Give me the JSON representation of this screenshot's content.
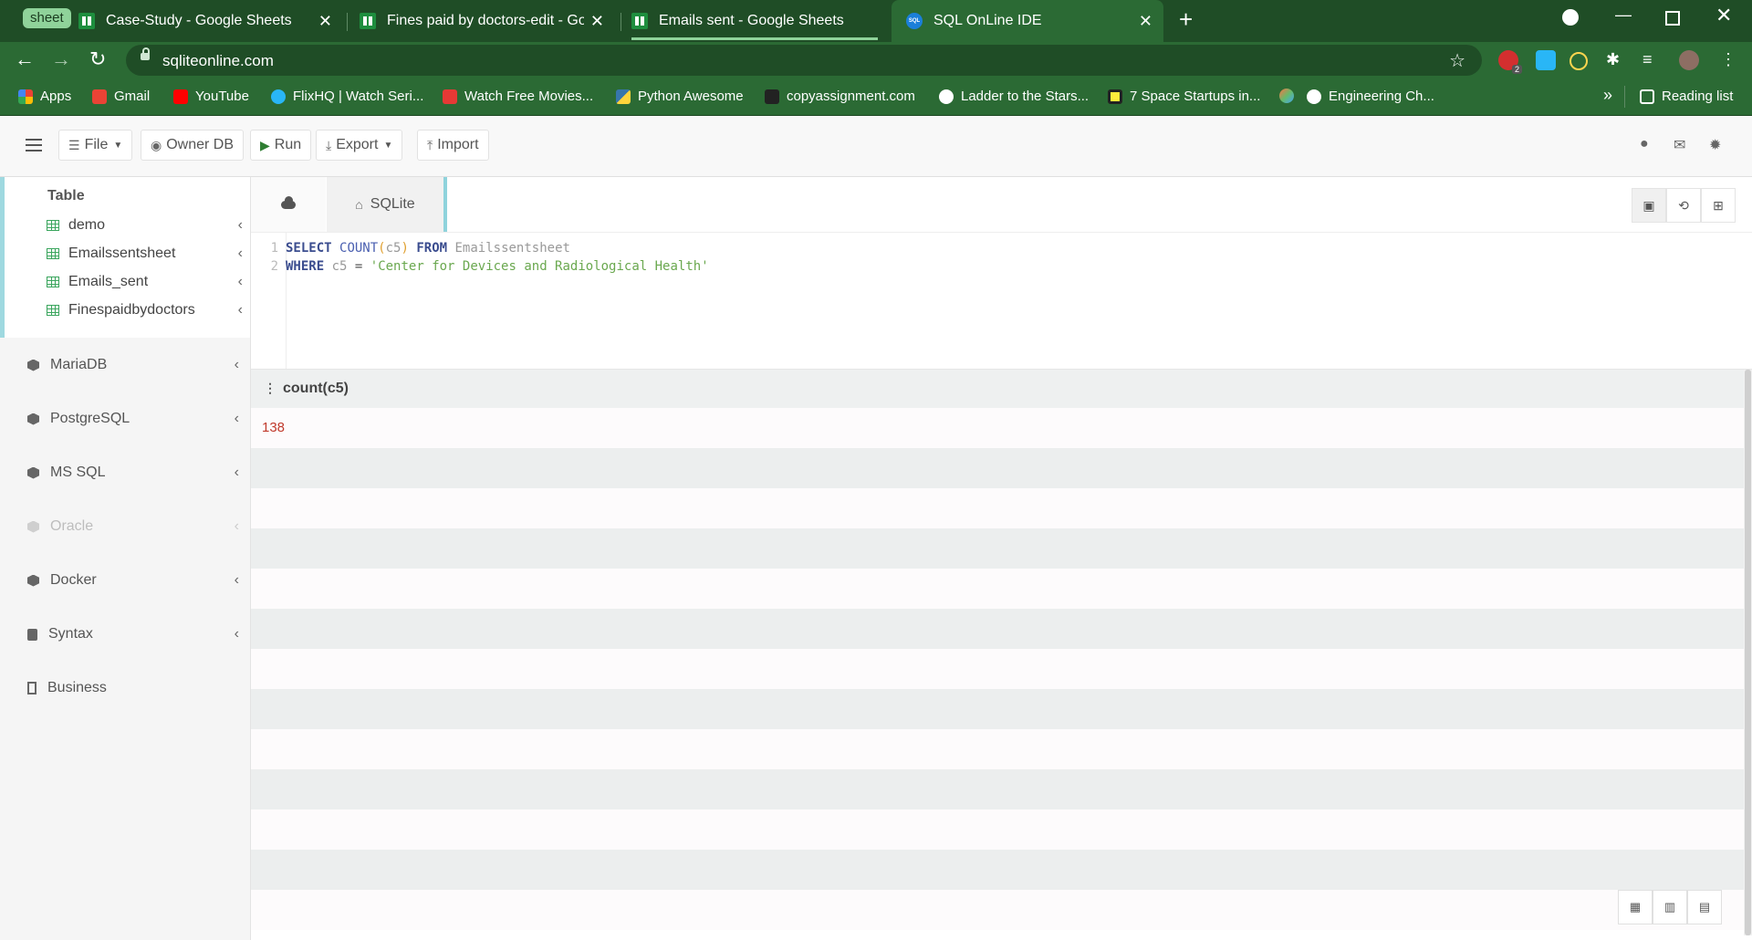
{
  "browser": {
    "tab_group_label": "sheet",
    "tabs": [
      {
        "title": "Case-Study - Google Sheets",
        "icon": "google-sheets-icon"
      },
      {
        "title": "Fines paid by doctors-edit - Goo",
        "icon": "google-sheets-icon"
      },
      {
        "title": "Emails sent - Google Sheets",
        "icon": "google-sheets-icon"
      },
      {
        "title": "SQL OnLine IDE",
        "icon": "sql-icon",
        "active": true
      }
    ],
    "url": "sqliteonline.com",
    "extension_badge": "2",
    "bookmarks": [
      {
        "label": "Apps",
        "icon": "apps-grid-icon",
        "color": "#f4b400"
      },
      {
        "label": "Gmail",
        "icon": "gmail-icon",
        "color": "#ea4335"
      },
      {
        "label": "YouTube",
        "icon": "youtube-icon",
        "color": "#ff0000"
      },
      {
        "label": "FlixHQ | Watch Seri...",
        "icon": "flixhq-icon",
        "color": "#29b6f6"
      },
      {
        "label": "Watch Free Movies...",
        "icon": "play-icon",
        "color": "#e53935"
      },
      {
        "label": "Python Awesome",
        "icon": "python-icon",
        "color": "#ffd43b"
      },
      {
        "label": "copyassignment.com",
        "icon": "copyassignment-icon",
        "color": "#222222"
      },
      {
        "label": "Ladder to the Stars...",
        "icon": "rocket-icon",
        "color": "#ffffff"
      },
      {
        "label": "7 Space Startups in...",
        "icon": "square-logo-icon",
        "color": "#ffeb3b"
      },
      {
        "label": "",
        "icon": "colorful-logo-icon",
        "color": "#ff7043"
      },
      {
        "label": "Engineering Ch...",
        "icon": "gear-icon",
        "color": "#ffffff"
      }
    ],
    "overflow": "»",
    "reading_list": "Reading list"
  },
  "toolbar": {
    "file": "File",
    "owner_db": "Owner DB",
    "run": "Run",
    "export": "Export",
    "import": "Import"
  },
  "sidebar": {
    "table_heading": "Table",
    "tables": [
      "demo",
      "Emailssentsheet",
      "Emails_sent",
      "Finespaidbydoctors"
    ],
    "databases": [
      {
        "label": "MariaDB",
        "disabled": false
      },
      {
        "label": "PostgreSQL",
        "disabled": false
      },
      {
        "label": "MS SQL",
        "disabled": false
      },
      {
        "label": "Oracle",
        "disabled": true
      },
      {
        "label": "Docker",
        "disabled": false
      },
      {
        "label": "Syntax",
        "disabled": false
      },
      {
        "label": "Business",
        "disabled": false
      }
    ]
  },
  "editor": {
    "tab_label": "SQLite",
    "lines": [
      {
        "num": "1",
        "text": "SELECT COUNT(c5) FROM Emailssentsheet"
      },
      {
        "num": "2",
        "text": "WHERE c5 = 'Center for Devices and Radiological Health'"
      }
    ]
  },
  "result": {
    "columns": [
      "count(c5)"
    ],
    "rows": [
      [
        "138"
      ]
    ]
  },
  "colors": {
    "browser_frame": "#1f4d26",
    "browser_toolbar": "#2b6a34",
    "accent": "#8fd3dc",
    "result_value": "#c0392b"
  }
}
